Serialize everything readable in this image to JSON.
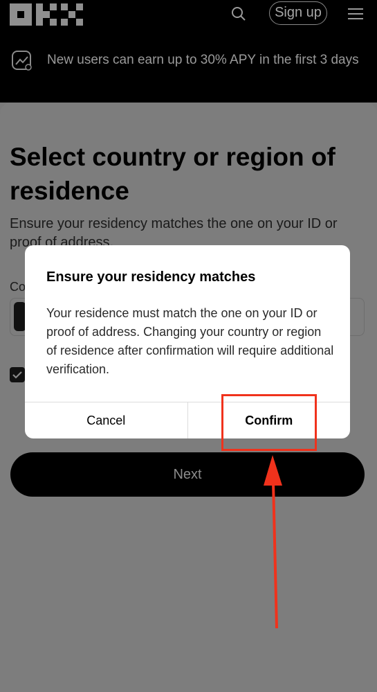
{
  "header": {
    "logo_text": "OKX",
    "signup_label": "Sign up"
  },
  "promo": {
    "text": "New users can earn up to 30% APY in the first 3 days"
  },
  "page": {
    "title": "Select country or region of residence",
    "subtitle": "Ensure your residency matches the one on your ID or proof of address.",
    "field_label": "Co",
    "next_label": "Next"
  },
  "dialog": {
    "title": "Ensure your residency matches",
    "body": "Your residence must match the one on your ID or proof of address. Changing your country or region of residence after confirmation will require additional verification.",
    "cancel_label": "Cancel",
    "confirm_label": "Confirm"
  },
  "colors": {
    "annotation": "#f0321c",
    "overlay": "#7d7d7d"
  }
}
